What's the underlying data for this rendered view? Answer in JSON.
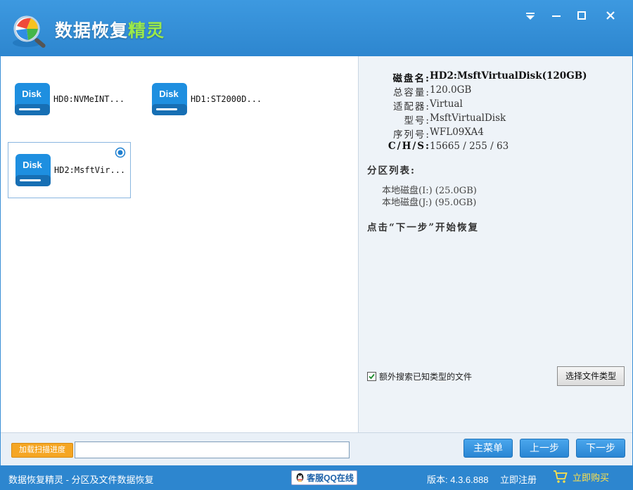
{
  "app": {
    "title_part1": "数据恢复",
    "title_part2": "精灵"
  },
  "window_controls": [
    "menu-icon",
    "minimize-icon",
    "maximize-icon",
    "close-icon"
  ],
  "disks": [
    {
      "icon_text": "Disk",
      "label": "HD0:NVMeINT...",
      "selected": false
    },
    {
      "icon_text": "Disk",
      "label": "HD1:ST2000D...",
      "selected": false
    },
    {
      "icon_text": "Disk",
      "label": "HD2:MsftVir...",
      "selected": true
    }
  ],
  "details": {
    "fields": [
      {
        "key": "磁盘名:",
        "value": "HD2:MsftVirtualDisk(120GB)"
      },
      {
        "key": "总容量:",
        "value": "120.0GB"
      },
      {
        "key": "适配器:",
        "value": "Virtual"
      },
      {
        "key": "型号:",
        "value": "MsftVirtualDisk"
      },
      {
        "key": "序列号:",
        "value": "WFL09XA4"
      },
      {
        "key": "C/H/S:",
        "value": "15665 / 255 / 63"
      }
    ],
    "partition_title": "分区列表:",
    "partitions": [
      "本地磁盘(I:) (25.0GB)",
      "本地磁盘(J:) (95.0GB)"
    ],
    "hint": "点击“下一步”开始恢复"
  },
  "options": {
    "extra_search_label": "额外搜索已知类型的文件",
    "extra_search_checked": true,
    "file_type_button": "选择文件类型"
  },
  "actions": {
    "load_progress": "加载扫描进度",
    "path_value": "",
    "main_menu": "主菜单",
    "prev": "上一步",
    "next": "下一步"
  },
  "status": {
    "title": "数据恢复精灵 - 分区及文件数据恢复",
    "qq": "客服QQ在线",
    "version": "版本: 4.3.6.888",
    "register": "立即注册",
    "buy": "立即购买"
  },
  "colors": {
    "header": "#2d86cf",
    "accent_green": "#9be94a",
    "button_blue": "#2a86d4",
    "orange": "#f5a623",
    "buy_yellow": "#ffe14a"
  }
}
